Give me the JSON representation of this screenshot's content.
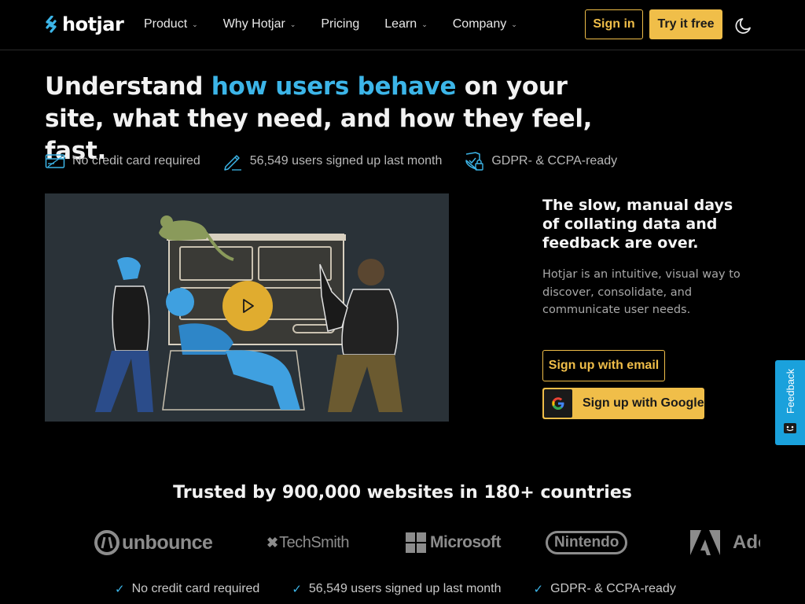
{
  "brand": {
    "name": "hotjar",
    "accent": "#f0be49",
    "highlight": "#3cb5e8"
  },
  "nav": {
    "links": [
      {
        "label": "Product",
        "has_dropdown": true
      },
      {
        "label": "Why Hotjar",
        "has_dropdown": true
      },
      {
        "label": "Pricing",
        "has_dropdown": false
      },
      {
        "label": "Learn",
        "has_dropdown": true
      },
      {
        "label": "Company",
        "has_dropdown": true
      }
    ],
    "signin_label": "Sign in",
    "try_label": "Try it free",
    "theme_icon": "moon-icon"
  },
  "hero": {
    "title_before": "Understand ",
    "title_highlight": "how users behave",
    "title_after": " on your site, what they need, and how they feel, fast.",
    "badges": [
      {
        "icon": "credit-card-icon",
        "text": "No credit card required"
      },
      {
        "icon": "pencil-icon",
        "text": "56,549 users signed up last month"
      },
      {
        "icon": "shield-lock-icon",
        "text": "GDPR- & CCPA-ready"
      }
    ]
  },
  "video": {
    "play_icon": "play-icon"
  },
  "right": {
    "title": "The slow, manual days of collating data and feedback are over.",
    "description": "Hotjar is an intuitive, visual way to discover, consolidate, and communicate user needs.",
    "email_button": "Sign up with email",
    "google_button": "Sign up with Google"
  },
  "feedback_tab": {
    "label": "Feedback"
  },
  "trust": {
    "title": "Trusted by 900,000 websites in 180+ countries",
    "logos": [
      "unbounce",
      "TechSmith",
      "Microsoft",
      "Nintendo",
      "Adobe"
    ]
  },
  "footer_badges": [
    "No credit card required",
    "56,549 users signed up last month",
    "GDPR- & CCPA-ready"
  ]
}
